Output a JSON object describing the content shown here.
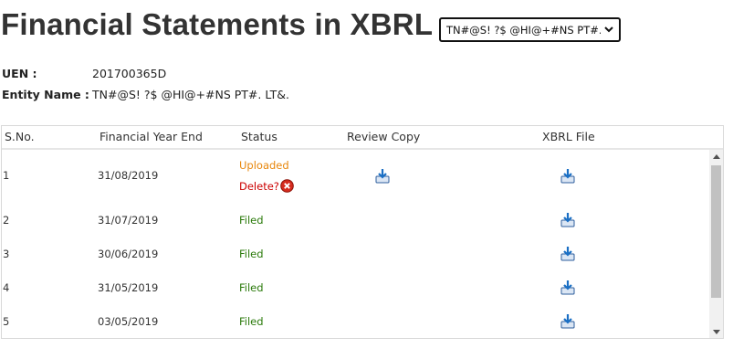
{
  "header": {
    "title": "Financial Statements in XBRL",
    "entity_select_value": "TN#@S! ?$ @HI@+#NS PT#. LT"
  },
  "info": {
    "uen_label": "UEN :",
    "uen_value": "201700365D",
    "entity_name_label": "Entity Name :",
    "entity_name_value": "TN#@S! ?$ @HI@+#NS PT#. LT&."
  },
  "table": {
    "columns": [
      "S.No.",
      "Financial Year End",
      "Status",
      "Review Copy",
      "XBRL File"
    ],
    "rows": [
      {
        "sno": "1",
        "fye": "31/08/2019",
        "status": "Uploaded",
        "delete_label": "Delete?",
        "review_copy_icon": "download-icon",
        "xbrl_icon": "download-icon"
      },
      {
        "sno": "2",
        "fye": "31/07/2019",
        "status": "Filed",
        "xbrl_icon": "download-icon"
      },
      {
        "sno": "3",
        "fye": "30/06/2019",
        "status": "Filed",
        "xbrl_icon": "download-icon"
      },
      {
        "sno": "4",
        "fye": "31/05/2019",
        "status": "Filed",
        "xbrl_icon": "download-icon"
      },
      {
        "sno": "5",
        "fye": "03/05/2019",
        "status": "Filed",
        "xbrl_icon": "download-icon"
      }
    ]
  },
  "colors": {
    "filed": "#2b7a0b",
    "uploaded": "#e8870c",
    "delete": "#cc0000",
    "title": "#333333"
  }
}
